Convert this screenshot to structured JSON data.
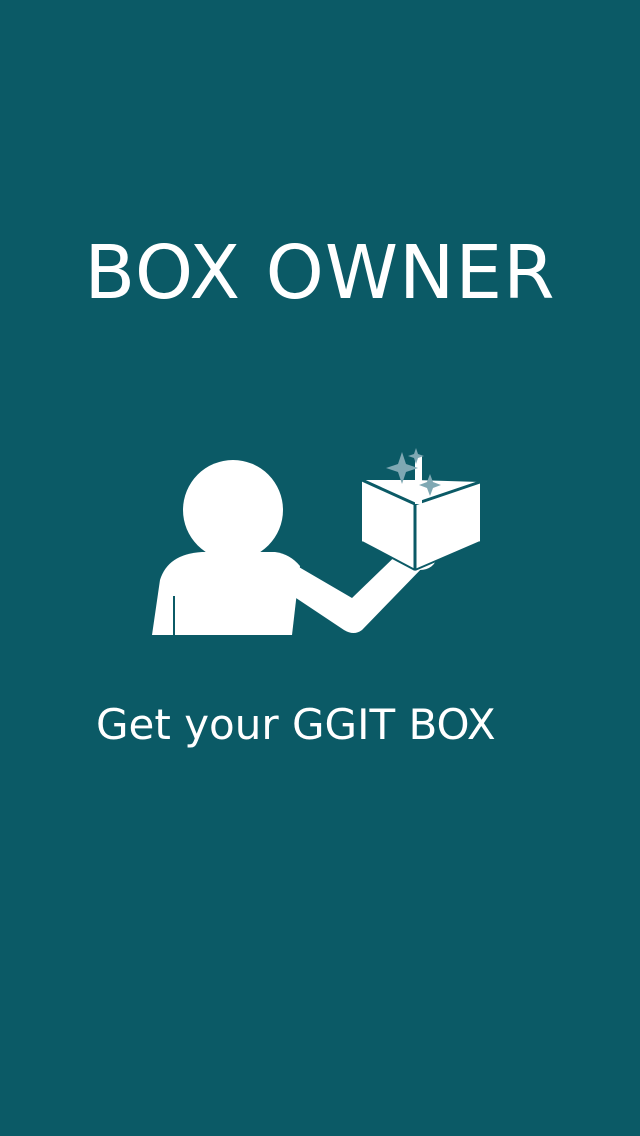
{
  "screen": {
    "title": "BOX OWNER",
    "subtitle": "Get your GGIT BOX"
  },
  "colors": {
    "background": "#0b5a66",
    "foreground": "#ffffff",
    "sparkle": "#7fa8b3"
  },
  "icons": {
    "illustration": "person-holding-box-icon"
  }
}
